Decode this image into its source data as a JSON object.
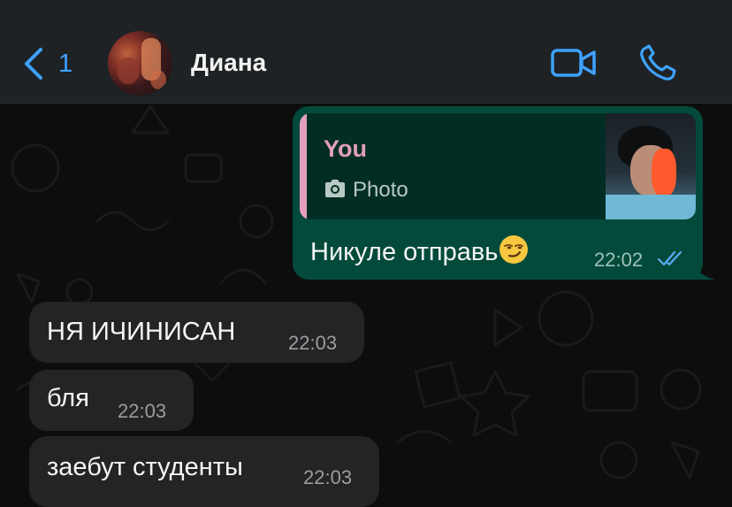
{
  "header": {
    "back_count": "1",
    "contact_name": "Диана"
  },
  "messages": [
    {
      "direction": "outgoing",
      "reply_to": {
        "sender": "You",
        "type_label": "Photo"
      },
      "text": "Никуле отправь",
      "emoji": "smirking-face",
      "time": "22:02",
      "status": "read"
    },
    {
      "direction": "incoming",
      "text": "НЯ ИЧИНИСАН",
      "time": "22:03"
    },
    {
      "direction": "incoming",
      "text": "бля",
      "time": "22:03"
    },
    {
      "direction": "incoming",
      "text": "заебут студенты",
      "time": "22:03"
    }
  ],
  "colors": {
    "accent": "#3ea2ff",
    "outgoing_bubble": "#034a3b",
    "incoming_bubble": "#232426",
    "quote_accent": "#e39fbd",
    "header_bg": "#1e2224"
  },
  "icons": {
    "back": "chevron-left-icon",
    "video": "video-camera-icon",
    "call": "phone-icon",
    "quote_media": "camera-icon",
    "read_status": "double-check-icon"
  }
}
